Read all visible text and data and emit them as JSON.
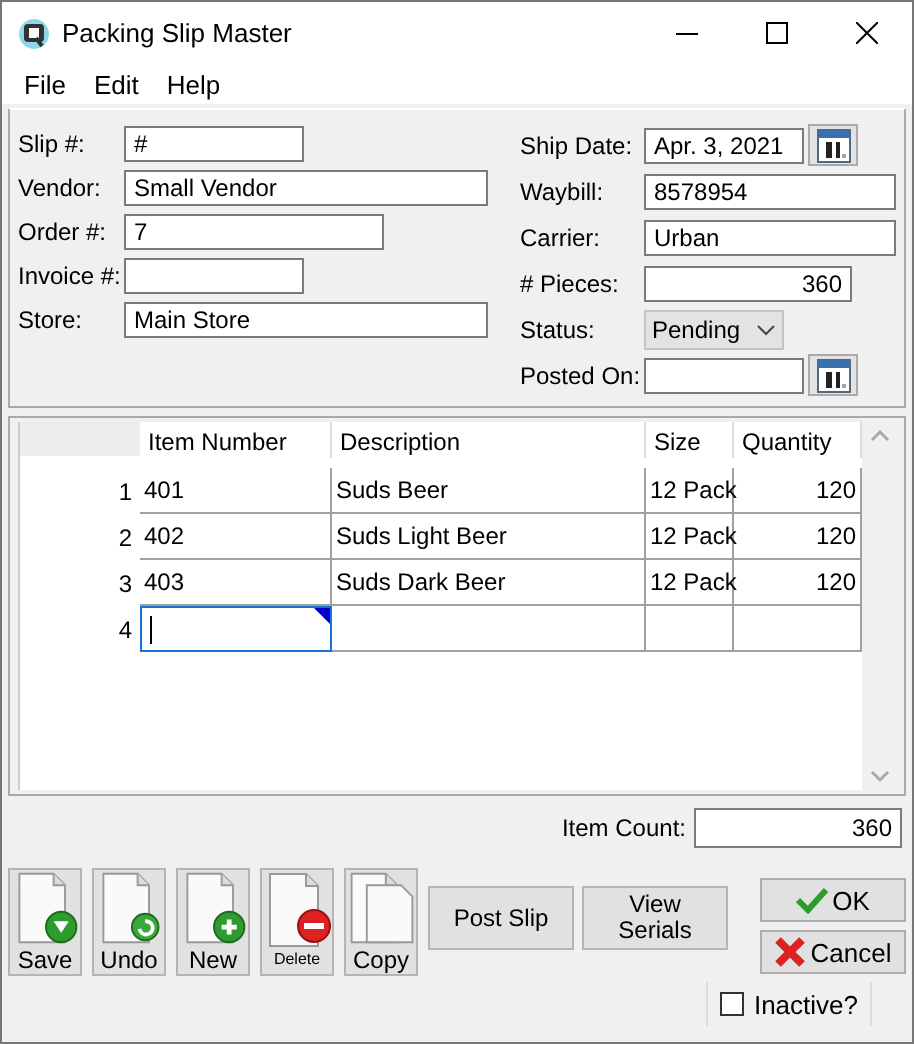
{
  "window": {
    "title": "Packing Slip Master"
  },
  "menu": [
    "File",
    "Edit",
    "Help"
  ],
  "left_fields": [
    {
      "label": "Slip #:",
      "value": "#"
    },
    {
      "label": "Vendor:",
      "value": "Small Vendor"
    },
    {
      "label": "Order #:",
      "value": "7"
    },
    {
      "label": "Invoice #:"
    },
    {
      "label": "Store:",
      "value": "Main Store"
    }
  ],
  "right_fields": [
    {
      "kind": "date",
      "label": "Ship Date:",
      "value": "Apr. 3, 2021"
    },
    {
      "kind": "text",
      "label": "Waybill:",
      "value": "8578954"
    },
    {
      "kind": "text",
      "label": "Carrier:",
      "value": "Urban"
    },
    {
      "kind": "number",
      "label": "# Pieces:",
      "value": "360"
    },
    {
      "kind": "dropdown",
      "label": "Status:",
      "value": "Pending"
    },
    {
      "kind": "date",
      "label": "Posted On:"
    }
  ],
  "grid": {
    "columns": [
      "Item Number",
      "Description",
      "Size",
      "Quantity"
    ],
    "rows": [
      {
        "number": "1",
        "cells": [
          "401",
          "Suds Beer",
          "12 Pack",
          "120"
        ],
        "selected": false
      },
      {
        "number": "2",
        "cells": [
          "402",
          "Suds Light Beer",
          "12 Pack",
          "120"
        ],
        "selected": false
      },
      {
        "number": "3",
        "cells": [
          "403",
          "Suds Dark Beer",
          "12 Pack",
          "120"
        ],
        "selected": false
      },
      {
        "number": "4",
        "cells": [
          "",
          "",
          "",
          ""
        ],
        "selected": true
      }
    ]
  },
  "item_count": {
    "label": "Item Count:",
    "value": "360"
  },
  "toolbar": [
    {
      "kind": "save",
      "label": "Save"
    },
    {
      "kind": "undo",
      "label": "Undo"
    },
    {
      "kind": "new",
      "label": "New"
    },
    {
      "kind": "delete",
      "label": "Delete"
    },
    {
      "kind": "copy",
      "label": "Copy"
    }
  ],
  "actions": [
    "Post Slip",
    "View Serials"
  ],
  "dialog_buttons": [
    {
      "kind": "ok",
      "label": "OK"
    },
    {
      "kind": "cancel",
      "label": "Cancel"
    }
  ],
  "inactive": {
    "label": "Inactive?",
    "checked": false
  }
}
